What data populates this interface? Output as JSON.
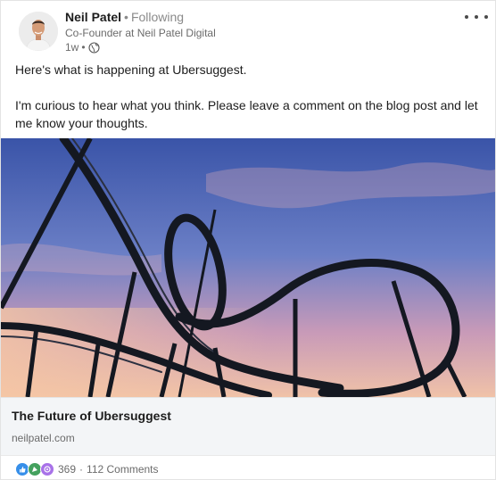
{
  "author": {
    "name": "Neil Patel",
    "follow_status": "Following",
    "headline": "Co-Founder at Neil Patel Digital",
    "time": "1w",
    "visibility_icon": "globe-icon"
  },
  "post": {
    "paragraphs": [
      "Here's what is happening at Ubersuggest.",
      "I'm curious to hear what you think. Please leave a comment on the blog post and let me know your thoughts."
    ]
  },
  "link_card": {
    "title": "The Future of Ubersuggest",
    "domain": "neilpatel.com"
  },
  "social": {
    "reactions": [
      "like-icon",
      "celebrate-icon",
      "curious-icon"
    ],
    "reaction_count": "369",
    "separator": "·",
    "comments": "112 Comments"
  },
  "colors": {
    "like": "#378fe9",
    "celebrate": "#44a15e",
    "curious": "#a872e8"
  }
}
